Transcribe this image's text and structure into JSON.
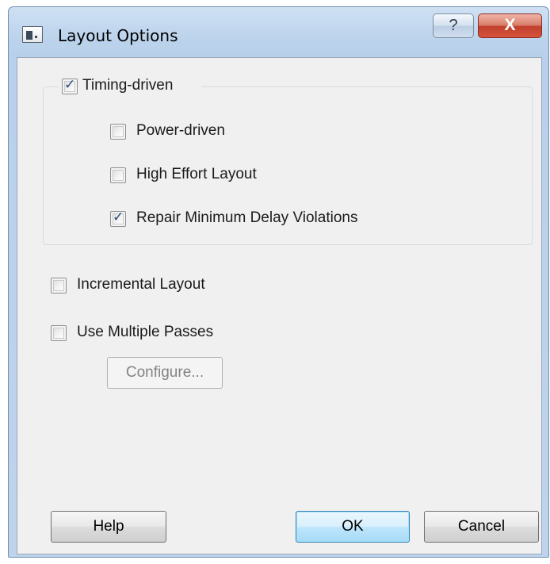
{
  "window": {
    "title": "Layout Options",
    "help_glyph": "?",
    "close_glyph": "X"
  },
  "timing_group": {
    "label": "Timing-driven",
    "checked": true,
    "options": [
      {
        "label": "Power-driven",
        "checked": false
      },
      {
        "label": "High Effort Layout",
        "checked": false
      },
      {
        "label": "Repair Minimum Delay Violations",
        "checked": true
      }
    ]
  },
  "incremental": {
    "label": "Incremental Layout",
    "checked": false
  },
  "multiple_passes": {
    "label": "Use Multiple Passes",
    "checked": false
  },
  "configure_button": {
    "label": "Configure...",
    "enabled": false
  },
  "buttons": {
    "help": "Help",
    "ok": "OK",
    "cancel": "Cancel"
  },
  "colors": {
    "close_button": "#c1402c",
    "check_mark": "#2f4a7a",
    "default_button_border": "#3c7fb1",
    "frame": "#b9d0ea"
  }
}
